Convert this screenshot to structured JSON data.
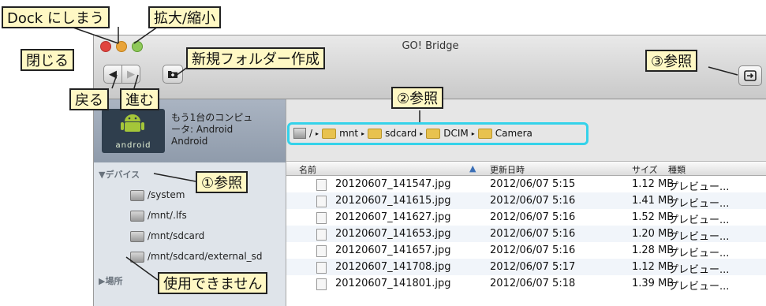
{
  "window": {
    "title": "GO! Bridge"
  },
  "toolbar": {
    "back_symbol": "◀",
    "forward_symbol": "▶"
  },
  "device": {
    "name_line1": "もう1台のコンピュ",
    "name_line2": "ータ: Android",
    "name_line3": "Android",
    "brand": "android"
  },
  "sidebar": {
    "devices_header": "▼デバイス",
    "items": [
      "/system",
      "/mnt/.lfs",
      "/mnt/sdcard",
      "/mnt/sdcard/external_sd"
    ],
    "places_header": "▶場所"
  },
  "path": {
    "segments": [
      "/",
      "mnt",
      "sdcard",
      "DCIM",
      "Camera"
    ]
  },
  "columns": {
    "name": "名前",
    "date": "更新日時",
    "size": "サイズ",
    "kind": "種類"
  },
  "files": [
    {
      "name": "20120607_141547.jpg",
      "date": "2012/06/07 5:15",
      "size": "1.12 MB",
      "kind": "プレビュー..."
    },
    {
      "name": "20120607_141615.jpg",
      "date": "2012/06/07 5:16",
      "size": "1.41 MB",
      "kind": "プレビュー..."
    },
    {
      "name": "20120607_141627.jpg",
      "date": "2012/06/07 5:16",
      "size": "1.52 MB",
      "kind": "プレビュー..."
    },
    {
      "name": "20120607_141653.jpg",
      "date": "2012/06/07 5:16",
      "size": "1.20 MB",
      "kind": "プレビュー..."
    },
    {
      "name": "20120607_141657.jpg",
      "date": "2012/06/07 5:16",
      "size": "1.28 MB",
      "kind": "プレビュー..."
    },
    {
      "name": "20120607_141708.jpg",
      "date": "2012/06/07 5:17",
      "size": "1.12 MB",
      "kind": "プレビュー..."
    },
    {
      "name": "20120607_141801.jpg",
      "date": "2012/06/07 5:18",
      "size": "1.39 MB",
      "kind": "プレビュー..."
    }
  ],
  "callouts": {
    "dock": "Dock にしまう",
    "zoom": "拡大/縮小",
    "close": "閉じる",
    "new_folder": "新規フォルダー作成",
    "back": "戻る",
    "forward": "進む",
    "browse1": "①参照",
    "browse2": "②参照",
    "browse3": "③参照",
    "unavailable": "使用できません"
  },
  "colors": {
    "callout_bg": "#fff8c4",
    "highlight": "#35d2ea"
  }
}
